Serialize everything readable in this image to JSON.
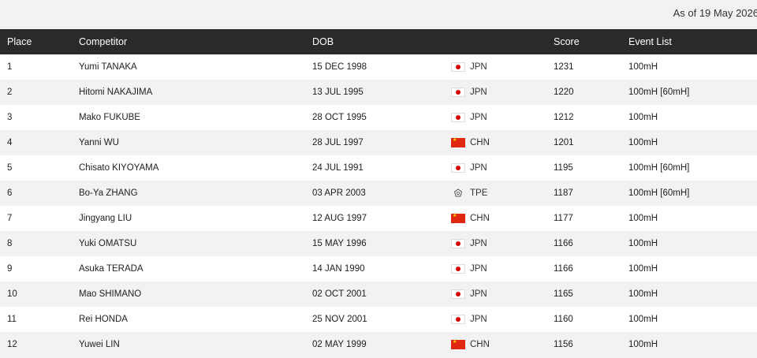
{
  "as_of": "As of 19 May 2026",
  "columns": {
    "place": "Place",
    "competitor": "Competitor",
    "dob": "DOB",
    "nationality": "",
    "score": "Score",
    "event_list": "Event List"
  },
  "rows": [
    {
      "place": "1",
      "competitor": "Yumi TANAKA",
      "dob": "15 DEC 1998",
      "flag": "jpn",
      "nat": "JPN",
      "score": "1231",
      "events": "100mH"
    },
    {
      "place": "2",
      "competitor": "Hitomi NAKAJIMA",
      "dob": "13 JUL 1995",
      "flag": "jpn",
      "nat": "JPN",
      "score": "1220",
      "events": "100mH [60mH]"
    },
    {
      "place": "3",
      "competitor": "Mako FUKUBE",
      "dob": "28 OCT 1995",
      "flag": "jpn",
      "nat": "JPN",
      "score": "1212",
      "events": "100mH"
    },
    {
      "place": "4",
      "competitor": "Yanni WU",
      "dob": "28 JUL 1997",
      "flag": "chn",
      "nat": "CHN",
      "score": "1201",
      "events": "100mH"
    },
    {
      "place": "5",
      "competitor": "Chisato KIYOYAMA",
      "dob": "24 JUL 1991",
      "flag": "jpn",
      "nat": "JPN",
      "score": "1195",
      "events": "100mH [60mH]"
    },
    {
      "place": "6",
      "competitor": "Bo-Ya ZHANG",
      "dob": "03 APR 2003",
      "flag": "tpe",
      "nat": "TPE",
      "score": "1187",
      "events": "100mH [60mH]"
    },
    {
      "place": "7",
      "competitor": "Jingyang LIU",
      "dob": "12 AUG 1997",
      "flag": "chn",
      "nat": "CHN",
      "score": "1177",
      "events": "100mH"
    },
    {
      "place": "8",
      "competitor": "Yuki OMATSU",
      "dob": "15 MAY 1996",
      "flag": "jpn",
      "nat": "JPN",
      "score": "1166",
      "events": "100mH"
    },
    {
      "place": "9",
      "competitor": "Asuka TERADA",
      "dob": "14 JAN 1990",
      "flag": "jpn",
      "nat": "JPN",
      "score": "1166",
      "events": "100mH"
    },
    {
      "place": "10",
      "competitor": "Mao SHIMANO",
      "dob": "02 OCT 2001",
      "flag": "jpn",
      "nat": "JPN",
      "score": "1165",
      "events": "100mH"
    },
    {
      "place": "11",
      "competitor": "Rei HONDA",
      "dob": "25 NOV 2001",
      "flag": "jpn",
      "nat": "JPN",
      "score": "1160",
      "events": "100mH"
    },
    {
      "place": "12",
      "competitor": "Yuwei LIN",
      "dob": "02 MAY 1999",
      "flag": "chn",
      "nat": "CHN",
      "score": "1156",
      "events": "100mH"
    }
  ]
}
